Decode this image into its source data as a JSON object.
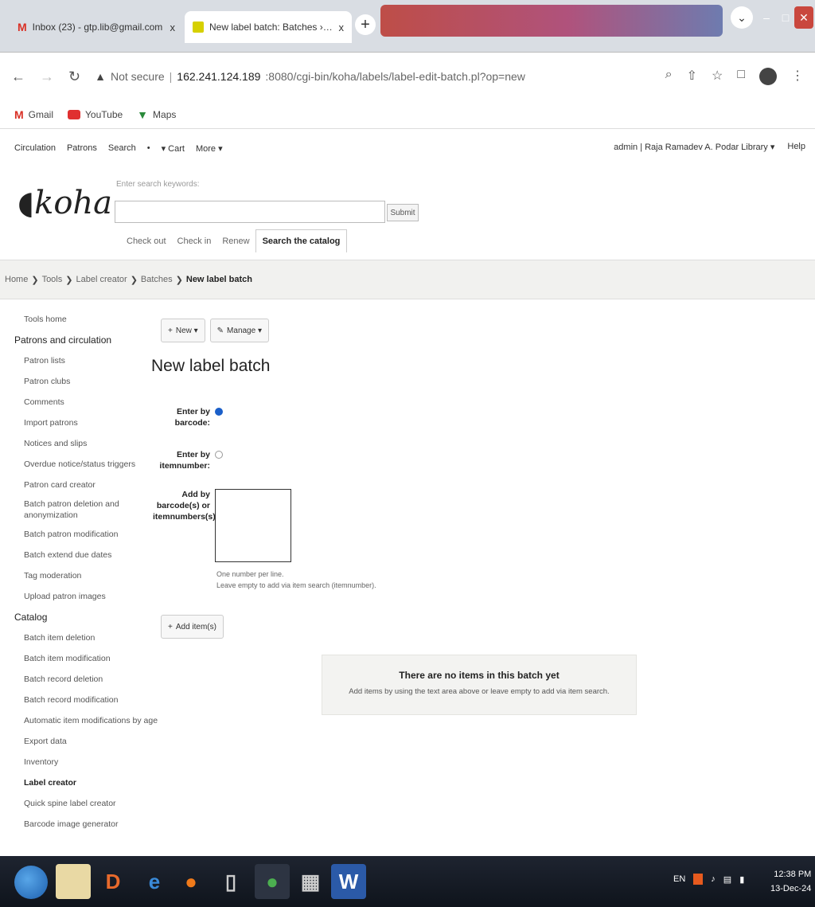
{
  "browser": {
    "tabs": [
      {
        "title": "Inbox (23) - gtp.lib@gmail.com",
        "close": "x"
      },
      {
        "title": "New label batch: Batches › Labels",
        "close": "x"
      }
    ],
    "new_tab": "+",
    "omnibox": {
      "security": "Not secure",
      "host": "162.241.124.189",
      "port_path": ":8080/cgi-bin/koha/labels/label-edit-batch.pl?op=new"
    },
    "bookmarks": [
      {
        "label": "Gmail"
      },
      {
        "label": "YouTube"
      },
      {
        "label": "Maps"
      }
    ]
  },
  "koha": {
    "topnav": [
      "Circulation",
      "Patrons",
      "Search",
      "•",
      "▾ Cart",
      "More ▾"
    ],
    "user": "admin | Raja Ramadev A. Podar Library ▾",
    "help": "Help",
    "logo": "koha",
    "search_hint": "Enter search keywords:",
    "submit": "Submit",
    "search_tabs": [
      "Check out",
      "Check in",
      "Renew",
      "Search the catalog"
    ],
    "breadcrumb": [
      "Home",
      "Tools",
      "Label creator",
      "Batches",
      "New label batch"
    ]
  },
  "sidebar": {
    "home": "Tools home",
    "sections": [
      {
        "title": "Patrons and circulation",
        "items": [
          "Patron lists",
          "Patron clubs",
          "Comments",
          "Import patrons",
          "Notices and slips",
          "Overdue notice/status triggers",
          "Patron card creator",
          "Batch patron deletion and anonymization",
          "Batch patron modification",
          "Batch extend due dates",
          "Tag moderation",
          "Upload patron images"
        ]
      },
      {
        "title": "Catalog",
        "items": [
          "Batch item deletion",
          "Batch item modification",
          "Batch record deletion",
          "Batch record modification",
          "Automatic item modifications by age",
          "Export data",
          "Inventory",
          "Label creator",
          "Quick spine label creator",
          "Barcode image generator"
        ]
      }
    ]
  },
  "main": {
    "toolbar": {
      "new": "New ▾",
      "manage": "Manage ▾"
    },
    "title": "New label batch",
    "form": {
      "barcode_label": "Enter by barcode:",
      "itemnumber_label": "Enter by itemnumber:",
      "add_label": "Add by barcode(s) or itemnumbers(s):",
      "hint1": "One number per line.",
      "hint2": "Leave empty to add via item search (itemnumber)."
    },
    "add_button": "Add item(s)",
    "empty": {
      "heading": "There are no items in this batch yet",
      "text": "Add items by using the text area above or leave empty to add via item search."
    }
  },
  "taskbar": {
    "lang": "EN",
    "time": "12:38 PM",
    "date": "13-Dec-24"
  }
}
